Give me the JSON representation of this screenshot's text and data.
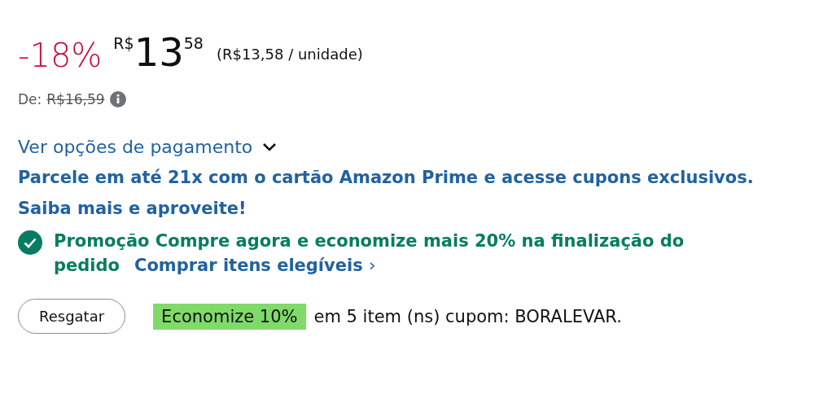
{
  "price": {
    "discount": "-18%",
    "currency": "R$",
    "whole": "13",
    "fraction": "58",
    "unit_price": "(R$13,58 / unidade)"
  },
  "list_price": {
    "label": "De:",
    "value": "R$16,59"
  },
  "payment_options": {
    "label": "Ver opções de pagamento"
  },
  "installments": "Parcele em até 21x com o cartão Amazon Prime e acesse cupons exclusivos. Saiba mais e aproveite!",
  "promotion": {
    "text": "Promoção Compre agora e economize mais 20% na finalização do pedido",
    "link": "Comprar itens elegíveis",
    "chevron": "›"
  },
  "coupon": {
    "button": "Resgatar",
    "badge": "Economize 10%",
    "text": "em 5 item (ns) cupom: BORALEVAR."
  }
}
